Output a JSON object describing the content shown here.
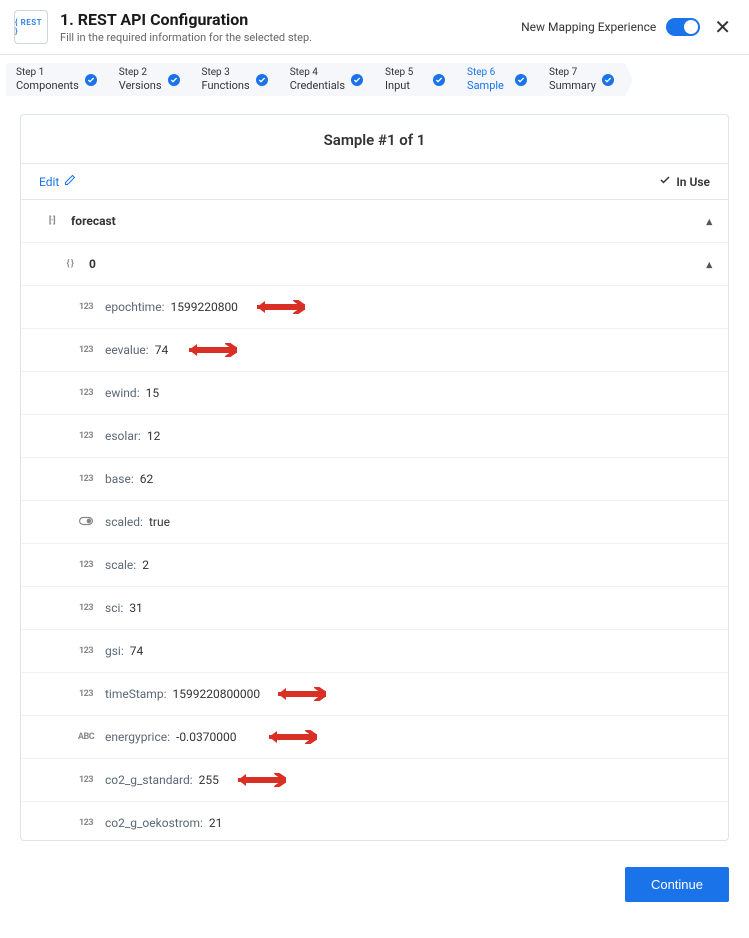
{
  "header": {
    "badge": "{ REST }",
    "title": "1. REST API Configuration",
    "subtitle": "Fill in the required information for the selected step.",
    "nme_label": "New Mapping Experience"
  },
  "stepper": [
    {
      "label": "Step 1",
      "name": "Components"
    },
    {
      "label": "Step 2",
      "name": "Versions"
    },
    {
      "label": "Step 3",
      "name": "Functions"
    },
    {
      "label": "Step 4",
      "name": "Credentials"
    },
    {
      "label": "Step 5",
      "name": "Input"
    },
    {
      "label": "Step 6",
      "name": "Sample",
      "active": true
    },
    {
      "label": "Step 7",
      "name": "Summary"
    }
  ],
  "card": {
    "title": "Sample #1 of 1",
    "edit": "Edit",
    "in_use": "In Use"
  },
  "tree": {
    "root_label": "forecast",
    "child_label": "0",
    "fields": [
      {
        "type": "123",
        "key": "epochtime:",
        "value": "1599220800",
        "arrow": true
      },
      {
        "type": "123",
        "key": "eevalue:",
        "value": "74",
        "arrow": true
      },
      {
        "type": "123",
        "key": "ewind:",
        "value": "15"
      },
      {
        "type": "123",
        "key": "esolar:",
        "value": "12"
      },
      {
        "type": "123",
        "key": "base:",
        "value": "62"
      },
      {
        "type": "bool",
        "key": "scaled:",
        "value": "true"
      },
      {
        "type": "123",
        "key": "scale:",
        "value": "2"
      },
      {
        "type": "123",
        "key": "sci:",
        "value": "31"
      },
      {
        "type": "123",
        "key": "gsi:",
        "value": "74"
      },
      {
        "type": "123",
        "key": "timeStamp:",
        "value": "1599220800000",
        "arrow": true
      },
      {
        "type": "ABC",
        "key": "energyprice:",
        "value": "-0.0370000",
        "arrow": true
      },
      {
        "type": "123",
        "key": "co2_g_standard:",
        "value": "255",
        "arrow": true
      },
      {
        "type": "123",
        "key": "co2_g_oekostrom:",
        "value": "21"
      }
    ]
  },
  "footer": {
    "continue": "Continue"
  }
}
